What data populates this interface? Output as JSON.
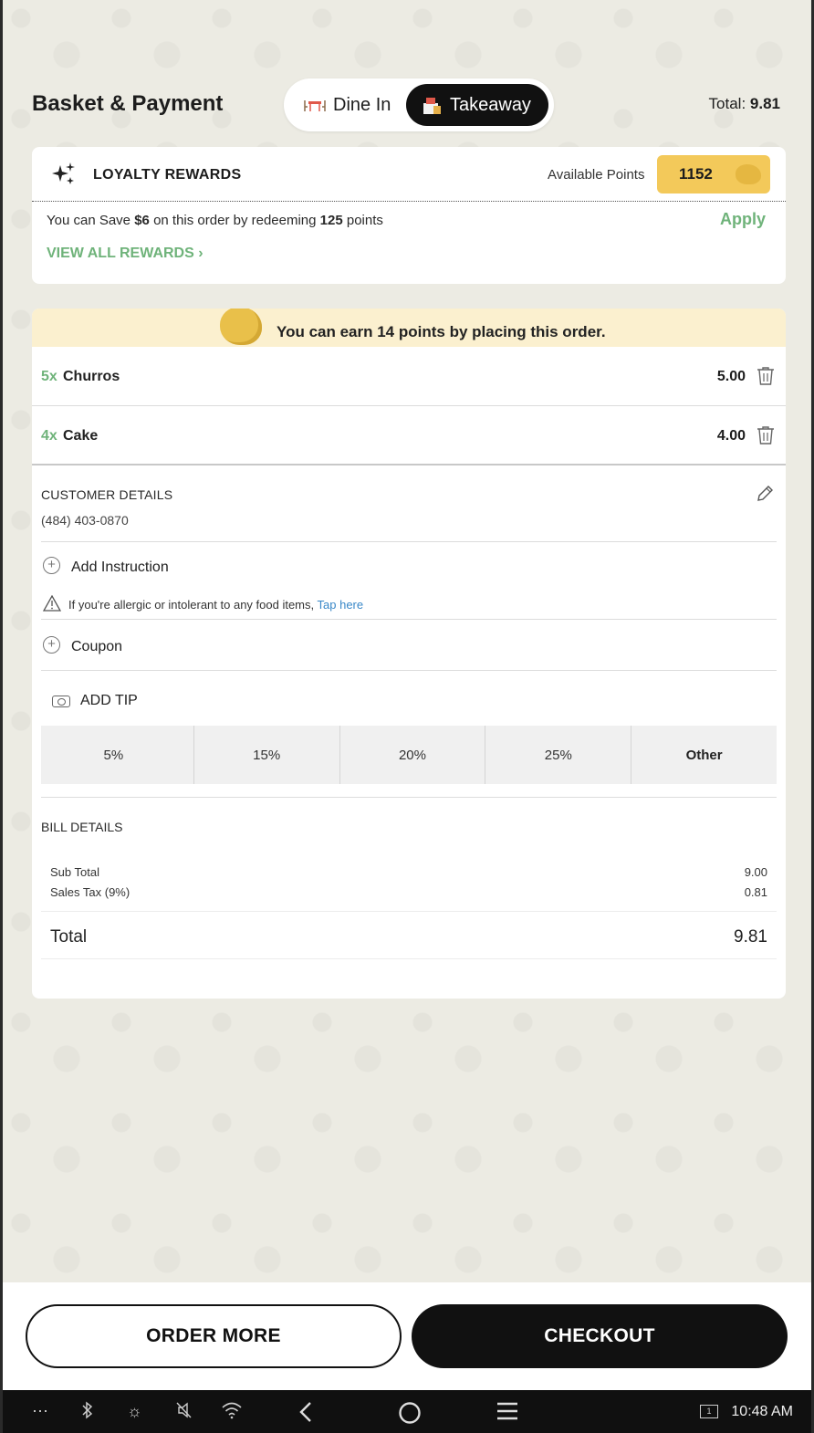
{
  "header": {
    "title": "Basket & Payment",
    "mode_dine_in": "Dine In",
    "mode_takeaway": "Takeaway",
    "selected_mode": "Takeaway",
    "total_label": "Total:",
    "total_value": "9.81"
  },
  "loyalty": {
    "title": "LOYALTY REWARDS",
    "available_label": "Available Points",
    "points": "1152",
    "save_prefix": "You can Save",
    "save_amount": "$6",
    "save_middle": "on this order by redeeming",
    "save_points": "125",
    "save_suffix": "points",
    "apply_label": "Apply",
    "view_all_label": "VIEW ALL REWARDS",
    "view_all_chevron": "›"
  },
  "earn_banner": {
    "text": "You can earn 14 points by placing this order."
  },
  "items": [
    {
      "qty": "5x",
      "name": "Churros",
      "price": "5.00"
    },
    {
      "qty": "4x",
      "name": "Cake",
      "price": "4.00"
    }
  ],
  "customer": {
    "label": "CUSTOMER DETAILS",
    "phone": "(484) 403-0870"
  },
  "instruction": {
    "add_label": "Add Instruction",
    "allergy_text": "If you're allergic or intolerant to any food items,",
    "allergy_link": "Tap here"
  },
  "coupon": {
    "label": "Coupon"
  },
  "tip": {
    "title": "ADD TIP",
    "options": [
      "5%",
      "15%",
      "20%",
      "25%",
      "Other"
    ]
  },
  "bill": {
    "label": "BILL DETAILS",
    "subtotal_label": "Sub Total",
    "subtotal_value": "9.00",
    "tax_label": "Sales Tax (9%)",
    "tax_value": "0.81",
    "total_label": "Total",
    "total_value": "9.81"
  },
  "actions": {
    "order_more": "ORDER MORE",
    "checkout": "CHECKOUT"
  },
  "system_bar": {
    "time": "10:48 AM",
    "screen_badge": "1"
  },
  "colors": {
    "accent_green": "#6fb37a",
    "points_yellow": "#f3c95a",
    "banner_cream": "#fbf0cf",
    "link_blue": "#3a88c8",
    "dark": "#111111"
  }
}
